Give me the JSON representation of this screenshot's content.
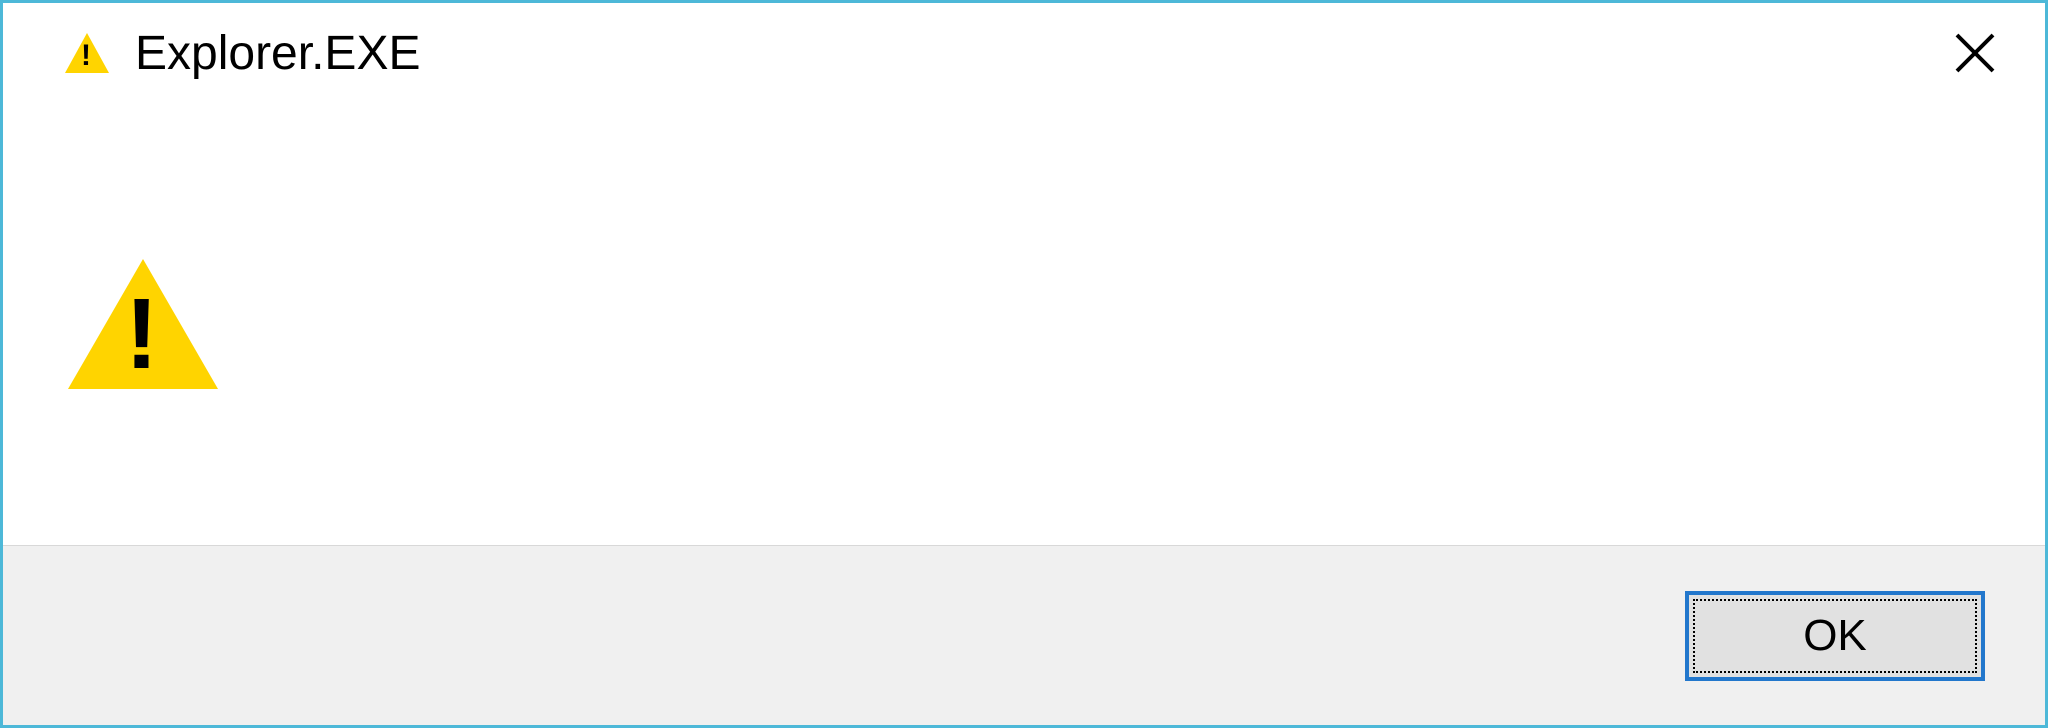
{
  "dialog": {
    "title": "Explorer.EXE",
    "icons": {
      "titlebar_icon": "warning-icon",
      "content_icon": "warning-icon",
      "close_glyph": "✕"
    },
    "buttons": {
      "ok_label": "OK"
    },
    "colors": {
      "border": "#4db8d8",
      "warning": "#ffd400",
      "footer_bg": "#f0f0f0",
      "button_border": "#2277cc"
    }
  }
}
